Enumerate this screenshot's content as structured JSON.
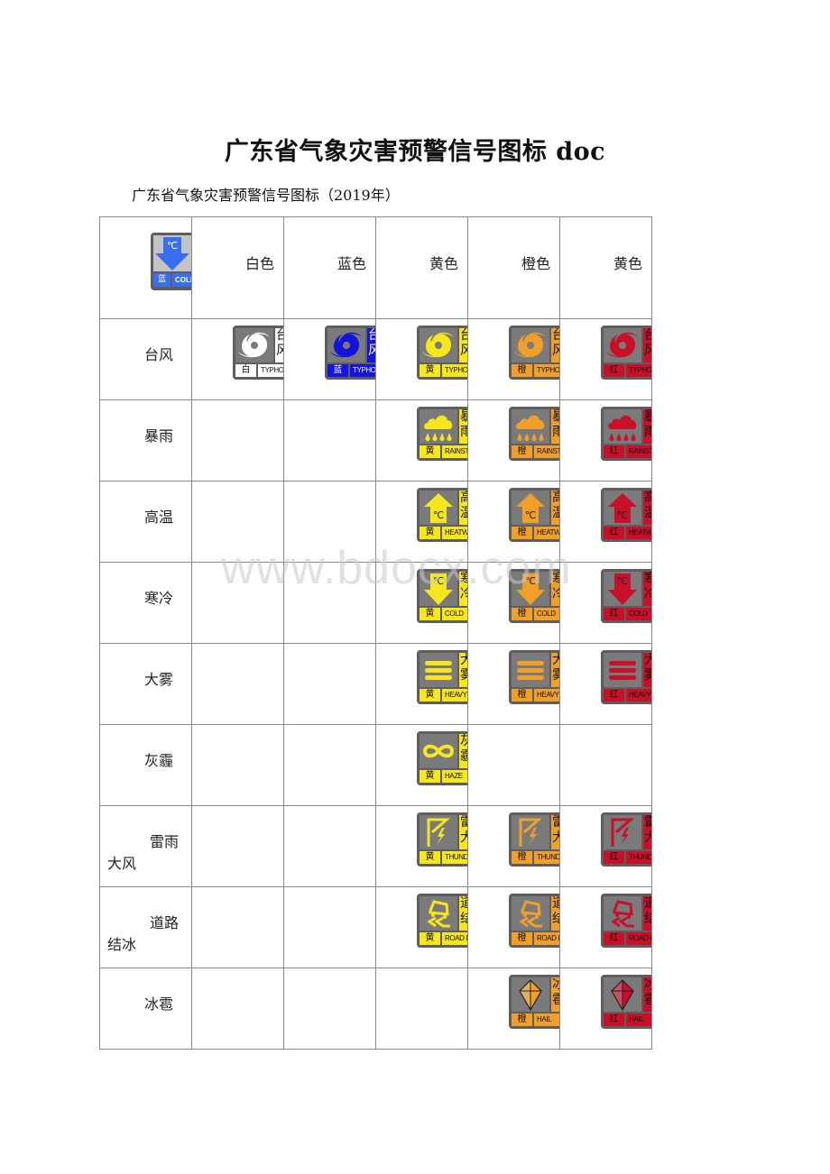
{
  "document": {
    "title": "广东省气象灾害预警信号图标 doc",
    "subtitle": "广东省气象灾害预警信号图标（2019年）",
    "watermark": "www.bdocx.com"
  },
  "legend_icon": {
    "icon": "cold-wave-blue-icon",
    "level": "蓝",
    "en": "COLD",
    "color": "#3a6ef0"
  },
  "colors": {
    "white": {
      "bg": "#ffffff",
      "symbol": "#ffffff",
      "label": "白"
    },
    "blue": {
      "bg": "#1414e0",
      "symbol": "#1414d8",
      "label": "蓝"
    },
    "yellow": {
      "bg": "#f5e61e",
      "symbol": "#f5e61e",
      "label": "黄"
    },
    "orange": {
      "bg": "#f0a02a",
      "symbol": "#f0a02a",
      "label": "橙"
    },
    "red": {
      "bg": "#c8102a",
      "symbol": "#c8102a",
      "label": "红"
    }
  },
  "table": {
    "headers": [
      "白色",
      "蓝色",
      "黄色",
      "橙色",
      "黄色"
    ],
    "column_colors": [
      "white",
      "blue",
      "yellow",
      "orange",
      "red"
    ],
    "rows": [
      {
        "label_l1": "台风",
        "label_l2": "",
        "symbol": "typhoon",
        "cn": "台风",
        "en": "TYPHOON",
        "levels": [
          true,
          true,
          true,
          true,
          true
        ]
      },
      {
        "label_l1": "暴雨",
        "label_l2": "",
        "symbol": "rainstorm",
        "cn": "暴雨",
        "en": "RAINSTORM",
        "levels": [
          false,
          false,
          true,
          true,
          true
        ]
      },
      {
        "label_l1": "高温",
        "label_l2": "",
        "symbol": "heat",
        "cn": "高温",
        "en": "HEATWAVE",
        "levels": [
          false,
          false,
          true,
          true,
          true
        ]
      },
      {
        "label_l1": "寒冷",
        "label_l2": "",
        "symbol": "cold",
        "cn": "寒冷",
        "en": "COLD",
        "levels": [
          false,
          false,
          true,
          true,
          true
        ]
      },
      {
        "label_l1": "大雾",
        "label_l2": "",
        "symbol": "fog",
        "cn": "大雾",
        "en": "HEAVY FOG",
        "levels": [
          false,
          false,
          true,
          true,
          true
        ]
      },
      {
        "label_l1": "灰霾",
        "label_l2": "",
        "symbol": "haze",
        "cn": "灰霾",
        "en": "HAZE",
        "levels": [
          false,
          false,
          true,
          false,
          false
        ]
      },
      {
        "label_l1": "雷雨",
        "label_l2": "大风",
        "symbol": "thunder",
        "cn": "雷大",
        "en": "THUNDER GALE",
        "levels": [
          false,
          false,
          true,
          true,
          true
        ]
      },
      {
        "label_l1": "道路",
        "label_l2": "结冰",
        "symbol": "road-ice",
        "cn": "道结",
        "en": "ROAD ICING",
        "levels": [
          false,
          false,
          true,
          true,
          true
        ]
      },
      {
        "label_l1": "冰雹",
        "label_l2": "",
        "symbol": "hail",
        "cn": "冰雹",
        "en": "HAIL",
        "levels": [
          false,
          false,
          false,
          true,
          true
        ]
      }
    ]
  }
}
